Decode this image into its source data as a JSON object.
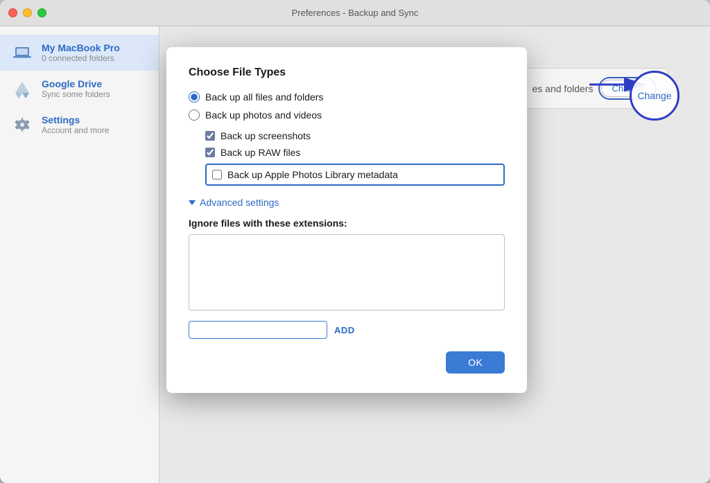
{
  "window": {
    "title": "Preferences - Backup and Sync"
  },
  "sidebar": {
    "items": [
      {
        "id": "macbook",
        "label": "My MacBook Pro",
        "sublabel": "0 connected folders",
        "active": true,
        "icon": "laptop"
      },
      {
        "id": "gdrive",
        "label": "Google Drive",
        "sublabel": "Sync some folders",
        "active": false,
        "icon": "drive"
      },
      {
        "id": "settings",
        "label": "Settings",
        "sublabel": "Account and more",
        "active": false,
        "icon": "gear"
      }
    ]
  },
  "modal": {
    "title": "Choose File Types",
    "radio_options": [
      {
        "id": "all_files",
        "label": "Back up all files and folders",
        "checked": true
      },
      {
        "id": "photos_videos",
        "label": "Back up photos and videos",
        "checked": false
      }
    ],
    "checkboxes": [
      {
        "id": "screenshots",
        "label": "Back up screenshots",
        "checked": true,
        "highlighted": false
      },
      {
        "id": "raw_files",
        "label": "Back up RAW files",
        "checked": true,
        "highlighted": false
      },
      {
        "id": "apple_photos",
        "label": "Back up Apple Photos Library metadata",
        "checked": false,
        "highlighted": true
      }
    ],
    "advanced_settings_label": "Advanced settings",
    "extensions_label": "Ignore files with these extensions:",
    "add_placeholder": "",
    "add_button_label": "ADD",
    "ok_button_label": "OK"
  },
  "bg_panel": {
    "text": "es and folders",
    "change_button": "Change"
  }
}
